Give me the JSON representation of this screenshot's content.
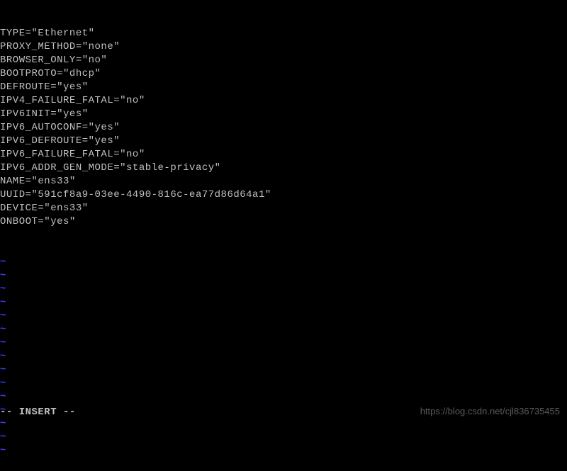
{
  "config_lines": [
    "TYPE=\"Ethernet\"",
    "PROXY_METHOD=\"none\"",
    "BROWSER_ONLY=\"no\"",
    "BOOTPROTO=\"dhcp\"",
    "DEFROUTE=\"yes\"",
    "IPV4_FAILURE_FATAL=\"no\"",
    "IPV6INIT=\"yes\"",
    "IPV6_AUTOCONF=\"yes\"",
    "IPV6_DEFROUTE=\"yes\"",
    "IPV6_FAILURE_FATAL=\"no\"",
    "IPV6_ADDR_GEN_MODE=\"stable-privacy\"",
    "NAME=\"ens33\"",
    "UUID=\"591cf8a9-03ee-4490-816c-ea77d86d64a1\"",
    "DEVICE=\"ens33\"",
    "ONBOOT=\"yes\""
  ],
  "tilde_char": "~",
  "tilde_count": 15,
  "status_text": "-- INSERT --",
  "watermark_text": "https://blog.csdn.net/cjl836735455"
}
